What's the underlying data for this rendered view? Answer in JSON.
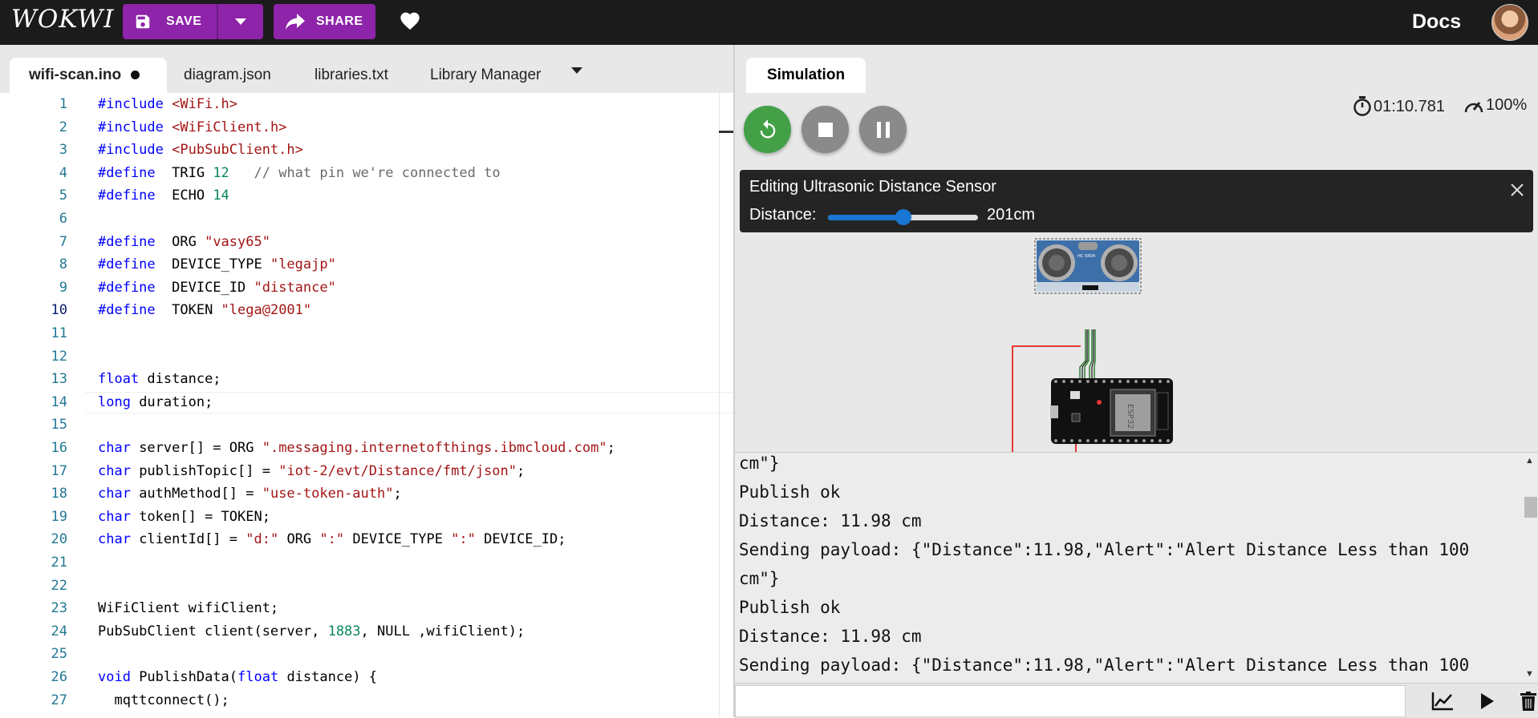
{
  "header": {
    "logo": "WOKWI",
    "save_label": "SAVE",
    "share_label": "SHARE",
    "docs_label": "Docs"
  },
  "editor": {
    "tabs": [
      {
        "label": "wifi-scan.ino",
        "modified": true
      },
      {
        "label": "diagram.json"
      },
      {
        "label": "libraries.txt"
      },
      {
        "label": "Library Manager"
      }
    ],
    "current_line": 10,
    "lines": [
      {
        "n": "1"
      },
      {
        "n": "2"
      },
      {
        "n": "3"
      },
      {
        "n": "4"
      },
      {
        "n": "5"
      },
      {
        "n": "6"
      },
      {
        "n": "7"
      },
      {
        "n": "8"
      },
      {
        "n": "9"
      },
      {
        "n": "10"
      },
      {
        "n": "11"
      },
      {
        "n": "12"
      },
      {
        "n": "13"
      },
      {
        "n": "14"
      },
      {
        "n": "15"
      },
      {
        "n": "16"
      },
      {
        "n": "17"
      },
      {
        "n": "18"
      },
      {
        "n": "19"
      },
      {
        "n": "20"
      },
      {
        "n": "21"
      },
      {
        "n": "22"
      },
      {
        "n": "23"
      },
      {
        "n": "24"
      },
      {
        "n": "25"
      },
      {
        "n": "26"
      },
      {
        "n": "27"
      }
    ],
    "code": [
      [
        [
          "kw",
          "#include"
        ],
        [
          "str",
          " <WiFi.h>"
        ]
      ],
      [
        [
          "kw",
          "#include"
        ],
        [
          "str",
          " <WiFiClient.h>"
        ]
      ],
      [
        [
          "kw",
          "#include"
        ],
        [
          "str",
          " <PubSubClient.h>"
        ]
      ],
      [
        [
          "kw",
          "#define"
        ],
        [
          "",
          "  TRIG "
        ],
        [
          "num",
          "12"
        ],
        [
          "cmt",
          "   // what pin we're connected to"
        ]
      ],
      [
        [
          "kw",
          "#define"
        ],
        [
          "",
          "  ECHO "
        ],
        [
          "num",
          "14"
        ]
      ],
      [],
      [
        [
          "kw",
          "#define"
        ],
        [
          "",
          "  ORG "
        ],
        [
          "str",
          "\"vasy65\""
        ]
      ],
      [
        [
          "kw",
          "#define"
        ],
        [
          "",
          "  DEVICE_TYPE "
        ],
        [
          "str",
          "\"legajp\""
        ]
      ],
      [
        [
          "kw",
          "#define"
        ],
        [
          "",
          "  DEVICE_ID "
        ],
        [
          "str",
          "\"distance\""
        ]
      ],
      [
        [
          "kw",
          "#define"
        ],
        [
          "",
          "  TOKEN "
        ],
        [
          "str",
          "\"lega@2001\""
        ]
      ],
      [],
      [],
      [
        [
          "kw",
          "float"
        ],
        [
          "",
          " distance;"
        ]
      ],
      [
        [
          "kw",
          "long"
        ],
        [
          "",
          " duration;"
        ]
      ],
      [],
      [
        [
          "kw",
          "char"
        ],
        [
          "",
          " server[] = ORG "
        ],
        [
          "str",
          "\".messaging.internetofthings.ibmcloud.com\""
        ],
        [
          "",
          ";"
        ]
      ],
      [
        [
          "kw",
          "char"
        ],
        [
          "",
          " publishTopic[] = "
        ],
        [
          "str",
          "\"iot-2/evt/Distance/fmt/json\""
        ],
        [
          "",
          ";"
        ]
      ],
      [
        [
          "kw",
          "char"
        ],
        [
          "",
          " authMethod[] = "
        ],
        [
          "str",
          "\"use-token-auth\""
        ],
        [
          "",
          ";"
        ]
      ],
      [
        [
          "kw",
          "char"
        ],
        [
          "",
          " token[] = TOKEN;"
        ]
      ],
      [
        [
          "kw",
          "char"
        ],
        [
          "",
          " clientId[] = "
        ],
        [
          "str",
          "\"d:\""
        ],
        [
          "",
          " ORG "
        ],
        [
          "str",
          "\":\""
        ],
        [
          "",
          " DEVICE_TYPE "
        ],
        [
          "str",
          "\":\""
        ],
        [
          "",
          " DEVICE_ID;"
        ]
      ],
      [],
      [],
      [
        [
          "",
          "WiFiClient wifiClient;"
        ]
      ],
      [
        [
          "",
          "PubSubClient client(server, "
        ],
        [
          "num",
          "1883"
        ],
        [
          "",
          ", NULL ,wifiClient);"
        ]
      ],
      [],
      [
        [
          "kw",
          "void"
        ],
        [
          "",
          " PublishData("
        ],
        [
          "kw",
          "float"
        ],
        [
          "",
          " distance) {"
        ]
      ],
      [
        [
          "",
          "  mqttconnect();"
        ]
      ]
    ]
  },
  "simulation": {
    "tab_label": "Simulation",
    "timer": "01:10.781",
    "speed": "100%",
    "edit_title": "Editing Ultrasonic Distance Sensor",
    "distance_label": "Distance:",
    "distance_value": "201cm",
    "distance_fraction": 0.5,
    "sensor_label": "HC-SR04",
    "chip_label": "ESP32"
  },
  "serial": {
    "lines": [
      "cm\"}",
      "Publish ok",
      "Distance: 11.98 cm",
      "Sending payload: {\"Distance\":11.98,\"Alert\":\"Alert Distance Less than 100",
      "cm\"}",
      "Publish ok",
      "Distance: 11.98 cm",
      "Sending payload: {\"Distance\":11.98,\"Alert\":\"Alert Distance Less than 100"
    ]
  },
  "colors": {
    "brand": "#8e24aa",
    "restart": "#43a047",
    "slider": "#1976d2"
  }
}
